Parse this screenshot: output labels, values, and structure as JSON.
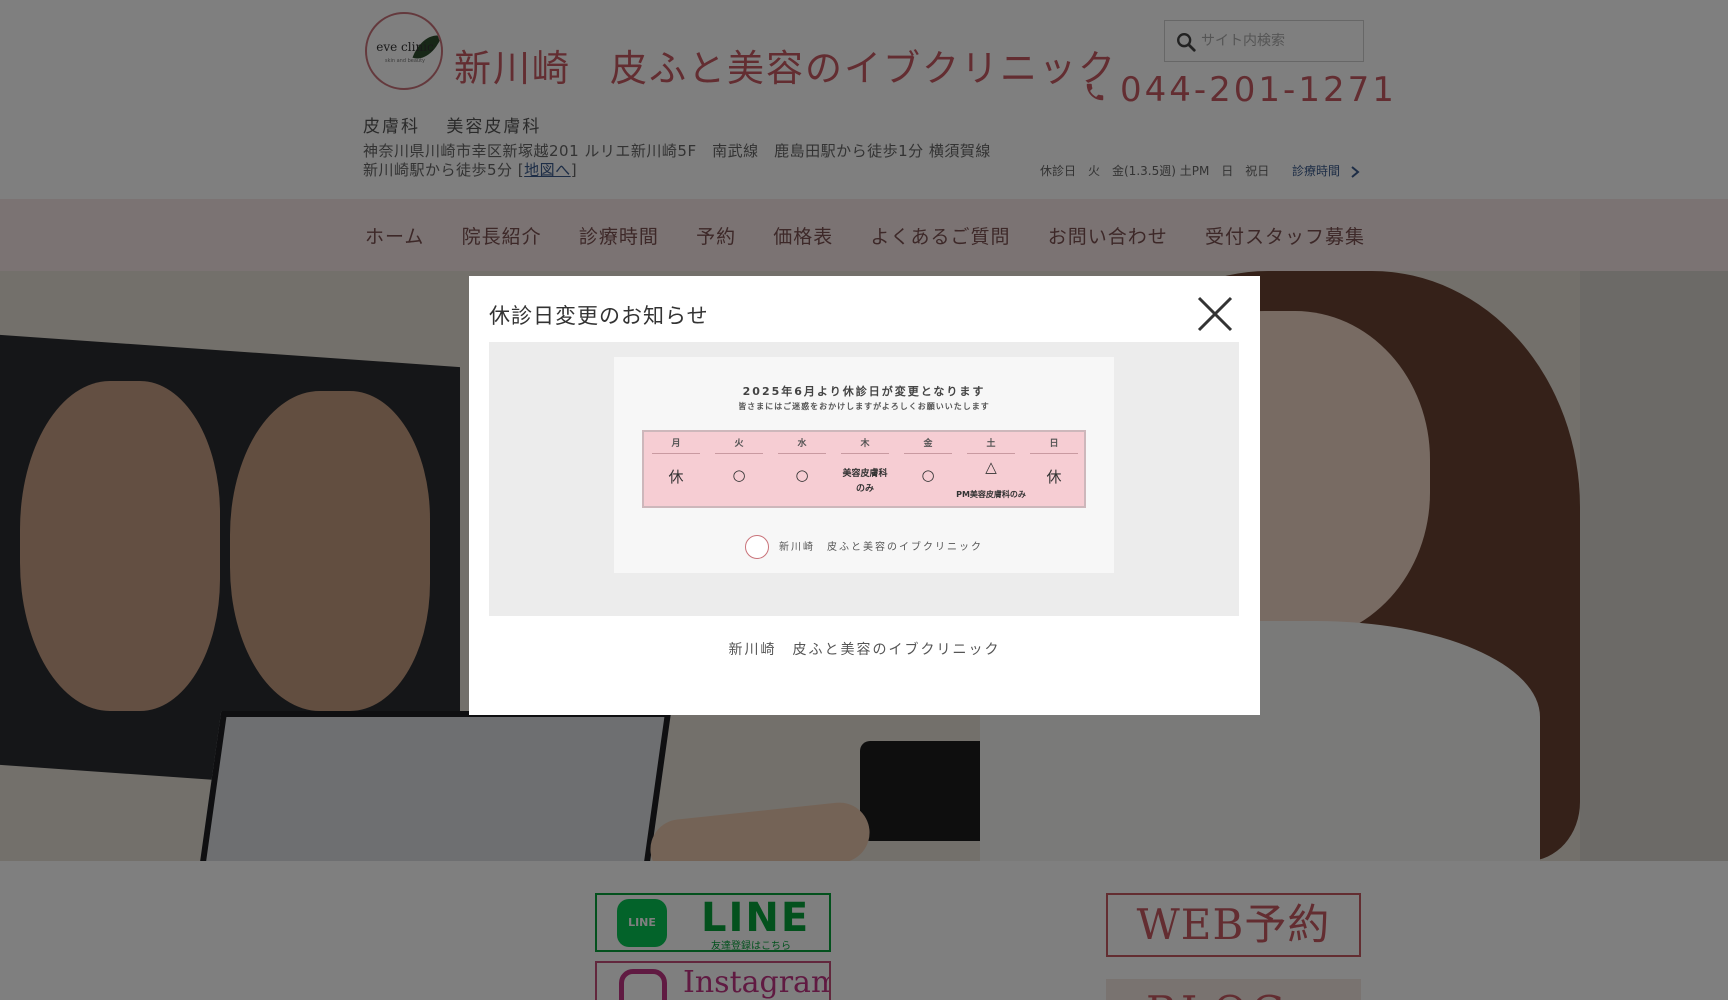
{
  "header": {
    "logo_text": "eve clinic",
    "logo_sub": "skin and beauty",
    "site_title": "新川崎　皮ふと美容のイブクリニック",
    "departments": "皮膚科　 美容皮膚科",
    "address": "神奈川県川崎市幸区新塚越201 ルリエ新川崎5F　南武線　鹿島田駅から徒歩1分 横須賀線　新川崎駅から徒歩5分 [",
    "map_link": "地図へ",
    "address_close": "]",
    "search_placeholder": "サイト内検索",
    "phone": "044-201-1271",
    "closed_info": "休診日　火　金(1.3.5週) 土PM　日　祝日",
    "hours_link": "診療時間"
  },
  "nav": {
    "items": [
      "ホーム",
      "院長紹介",
      "診療時間",
      "予約",
      "価格表",
      "よくあるご質問",
      "お問い合わせ",
      "受付スタッフ募集"
    ]
  },
  "modal": {
    "title": "休診日変更のお知らせ",
    "notice_heading": "2025年6月より休診日が変更となります",
    "notice_sub": "皆さまにはご迷惑をおかけしますがよろしくお願いいたします",
    "schedule": [
      {
        "day": "月",
        "mark": "休"
      },
      {
        "day": "火",
        "mark": "○"
      },
      {
        "day": "水",
        "mark": "○"
      },
      {
        "day": "木",
        "note_line1": "美容皮膚科",
        "note_line2": "のみ"
      },
      {
        "day": "金",
        "mark": "○"
      },
      {
        "day": "土",
        "mark": "△",
        "note": "PM美容皮膚科のみ"
      },
      {
        "day": "日",
        "mark": "休"
      }
    ],
    "notice_footer": "新川崎　皮ふと美容のイブクリニック",
    "caption": "新川崎　皮ふと美容のイブクリニック"
  },
  "banners": {
    "line_icon": "LINE",
    "line_text": "LINE",
    "line_sub": "友達登録はこちら",
    "instagram_text": "Instagram",
    "web_reserve": "WEB予約",
    "blog": "BLOG"
  },
  "colors": {
    "brand": "#c65a63",
    "nav_bg": "#f6e7e7",
    "line_green": "#06c755",
    "overlay": "rgba(0,0,0,0.5)"
  },
  "icons": [
    "search-icon",
    "phone-icon",
    "chevron-right-icon",
    "close-icon",
    "line-icon",
    "instagram-icon"
  ]
}
